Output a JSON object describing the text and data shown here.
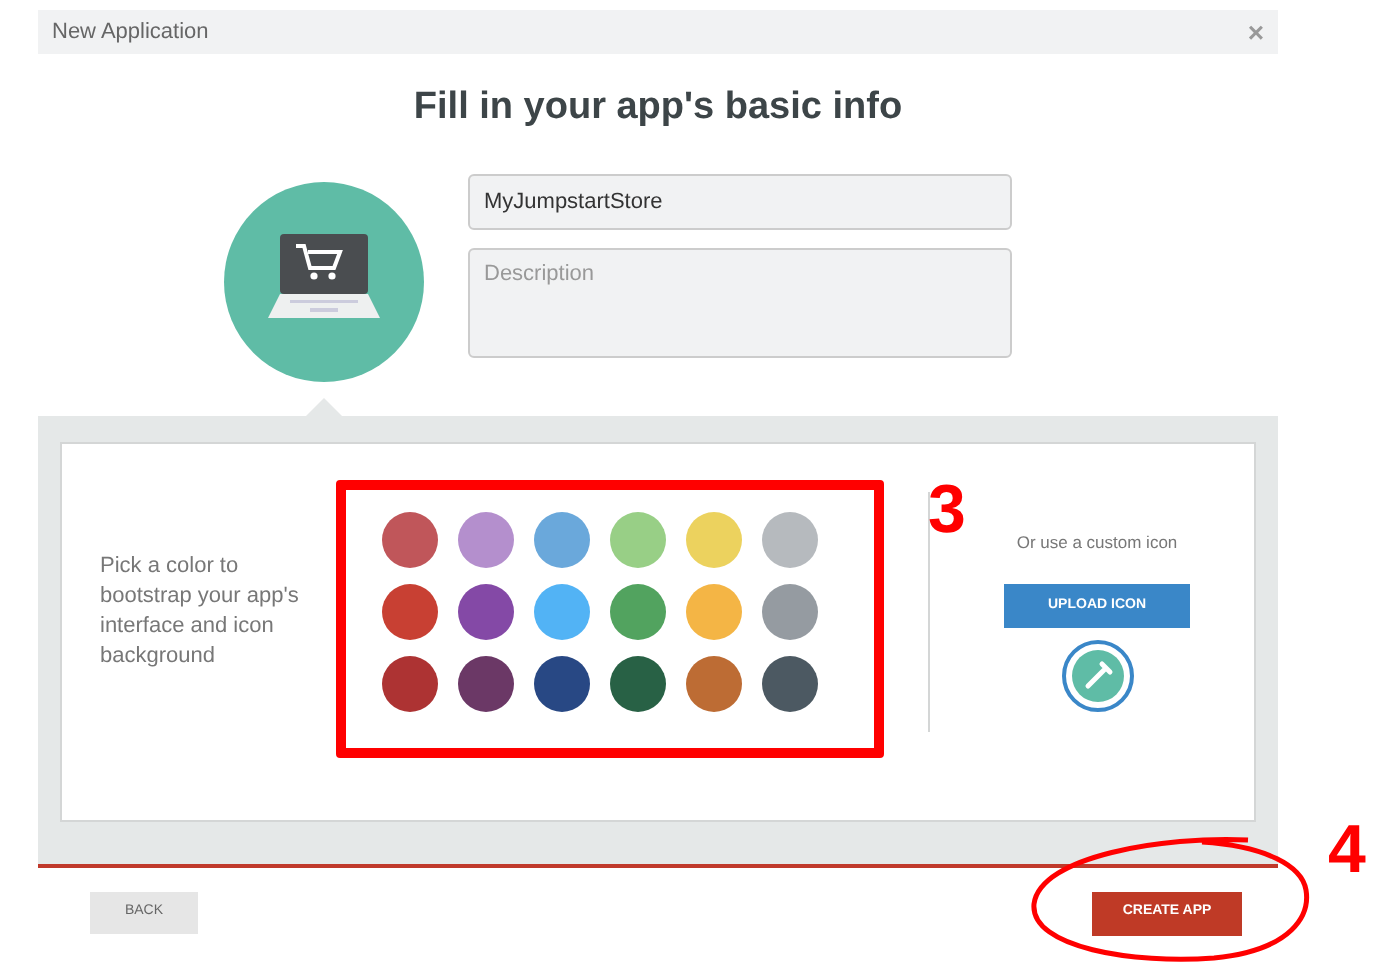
{
  "window": {
    "title": "New Application",
    "close": "×"
  },
  "heading": "Fill in your app's basic info",
  "name_field": {
    "value": "MyJumpstartStore"
  },
  "description_field": {
    "placeholder": "Description"
  },
  "color_prompt": "Pick a color to bootstrap your app's interface and icon background",
  "colors": [
    {
      "color": "#c0565a"
    },
    {
      "color": "#b48fcd"
    },
    {
      "color": "#6aa8db"
    },
    {
      "color": "#98cf86"
    },
    {
      "color": "#ecd25e"
    },
    {
      "color": "#b6babe"
    },
    {
      "color": "#c84033"
    },
    {
      "color": "#8449a6"
    },
    {
      "color": "#52b3f5"
    },
    {
      "color": "#52a35f"
    },
    {
      "color": "#f4b545"
    },
    {
      "color": "#959ba1"
    },
    {
      "color": "#ad3333"
    },
    {
      "color": "#6b3866"
    },
    {
      "color": "#284884"
    },
    {
      "color": "#286145"
    },
    {
      "color": "#bd6c34"
    },
    {
      "color": "#4c5962"
    }
  ],
  "custom_icon_label": "Or use a custom icon",
  "upload_button": "UPLOAD ICON",
  "back_button": "BACK",
  "create_button": "CREATE APP",
  "annotations": [
    "3",
    "4"
  ]
}
